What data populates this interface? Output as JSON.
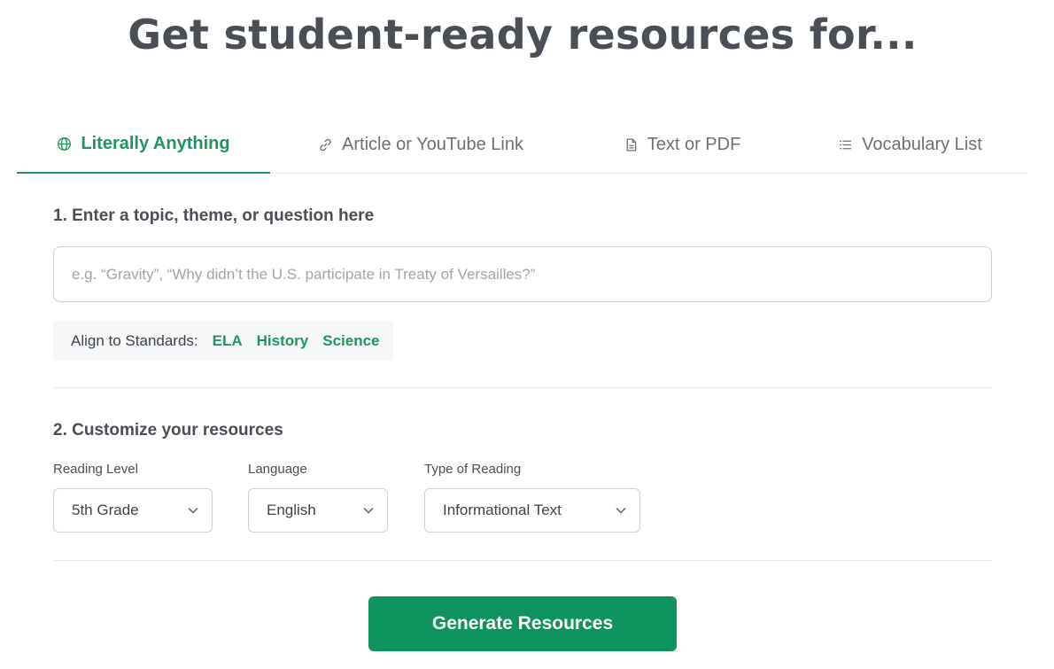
{
  "title": "Get student-ready resources for...",
  "tabs": [
    {
      "label": "Literally Anything",
      "icon": "globe-icon",
      "active": true
    },
    {
      "label": "Article or YouTube Link",
      "icon": "link-icon",
      "active": false
    },
    {
      "label": "Text or PDF",
      "icon": "document-icon",
      "active": false
    },
    {
      "label": "Vocabulary List",
      "icon": "list-icon",
      "active": false
    }
  ],
  "step1": {
    "heading": "1. Enter a topic, theme, or question here",
    "input_placeholder": "e.g. “Gravity”, “Why didn’t the U.S. participate in Treaty of Versailles?”",
    "input_value": "",
    "standards": {
      "label": "Align to Standards:",
      "options": [
        "ELA",
        "History",
        "Science"
      ]
    }
  },
  "step2": {
    "heading": "2. Customize your resources",
    "reading_level": {
      "label": "Reading Level",
      "value": "5th Grade"
    },
    "language": {
      "label": "Language",
      "value": "English"
    },
    "reading_type": {
      "label": "Type of Reading",
      "value": "Informational Text"
    }
  },
  "generate_label": "Generate Resources",
  "colors": {
    "accent": "#1f9562",
    "button": "#0f935e",
    "text": "#3f444b"
  }
}
